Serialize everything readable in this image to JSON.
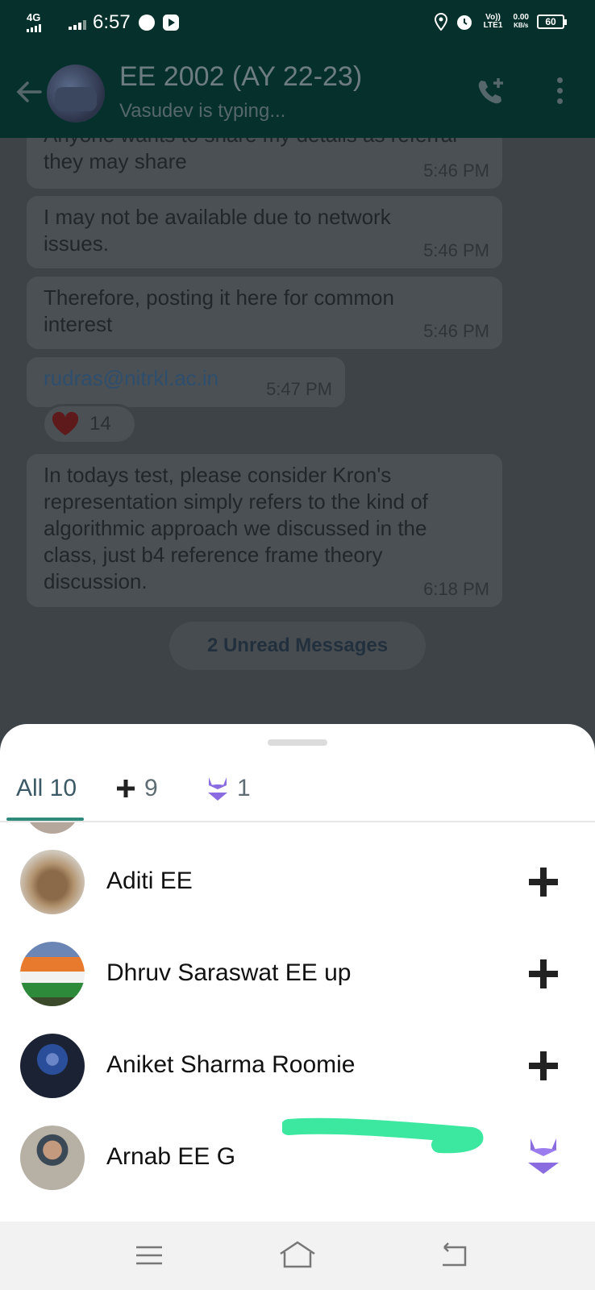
{
  "status_bar": {
    "network": "4G",
    "time": "6:57",
    "volte": "Vo)) LTE1",
    "speed_value": "0.00",
    "speed_unit": "KB/s",
    "battery": "60"
  },
  "header": {
    "title": "EE 2002 (AY 22-23)",
    "subtitle": "Vasudev is typing..."
  },
  "messages": [
    {
      "text": "Anyone wants to share my details as referral they may share",
      "time": "5:46 PM"
    },
    {
      "text": "I may not be available due to network issues.",
      "time": "5:46 PM"
    },
    {
      "text": "Therefore, posting it here for common interest",
      "time": "5:46 PM"
    },
    {
      "text": "rudras@nitrkl.ac.in",
      "time": "5:47 PM"
    },
    {
      "text": "In todays test, please consider Kron's representation simply refers to the kind of algorithmic approach we discussed in the class, just b4 reference frame theory discussion.",
      "time": "6:18 PM"
    }
  ],
  "reaction": {
    "emoji": "heart",
    "count": "14"
  },
  "unread_label": "2 Unread Messages",
  "reactions_sheet": {
    "tabs": [
      {
        "label": "All 10"
      },
      {
        "icon": "plus-icon",
        "count": "9"
      },
      {
        "icon": "bikini-emoji",
        "count": "1"
      }
    ],
    "members": [
      {
        "name": "Aditi EE",
        "reaction": "plus-icon"
      },
      {
        "name": "Dhruv Saraswat EE up",
        "reaction": "plus-icon"
      },
      {
        "name": "Aniket Sharma Roomie",
        "reaction": "plus-icon"
      },
      {
        "name": "Arnab EE G",
        "reaction": "bikini-emoji"
      }
    ]
  },
  "colors": {
    "header_bg": "#06302b",
    "accent": "#2f8a7a",
    "highlight_stroke": "#3ce8a0",
    "bikini": "#8a6ce0"
  }
}
